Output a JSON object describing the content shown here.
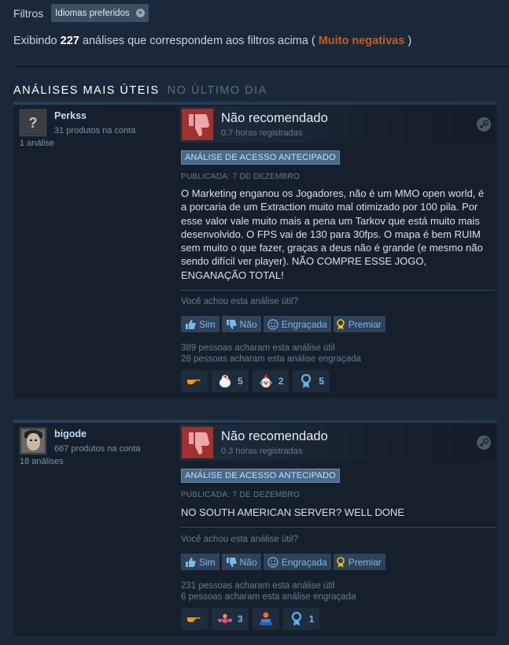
{
  "filters": {
    "label": "Filtros",
    "chip_label": "Idiomas preferidos",
    "chip_remove": "×"
  },
  "summary": {
    "prefix": "Exibindo",
    "count": "227",
    "middle": "análises que correspondem aos filtros acima (",
    "rating": "Muito negativas",
    "suffix": ")"
  },
  "section": {
    "title": "ANÁLISES MAIS ÚTEIS",
    "period": "NO ÚLTIMO DIA"
  },
  "colors": {
    "background": "#1b2838",
    "negative": "#c35c2c",
    "thumb_down": "#a13030",
    "link": "#7eb7e8"
  },
  "reviews": [
    {
      "author": "Perkss",
      "products_owned": "31 produtos na conta",
      "reviews_count": "1 análise",
      "avatar": "question-mark-avatar",
      "verdict": "Não recomendado",
      "hours": "0.7 horas registradas",
      "badge": "ANÁLISE DE ACESSO ANTECIPADO",
      "published": "PUBLICADA: 7 DE DEZEMBRO",
      "text": "O Marketing enganou os Jogadores, não é um MMO open world, é a porcaria de um Extraction muito mal otimizado por 100 pila. Por esse valor vale muito mais a pena um Tarkov que está muito mais desenvolvido. O FPS vai de 130 para 30fps. O mapa é bem RUIM sem muito o que fazer, graças a deus não é grande (e mesmo não sendo difícil ver player). NÃO COMPRE ESSE JOGO, ENGANAÇÃO TOTAL!",
      "helpful_question": "Você achou esta análise útil?",
      "buttons": {
        "yes": "Sim",
        "no": "Não",
        "funny": "Engraçada",
        "award": "Premiar"
      },
      "helpful_count": "389 pessoas acharam esta análise útil",
      "funny_count": "28 pessoas acharam esta análise engraçada",
      "awards": [
        {
          "icon": "hand-point-icon",
          "count": ""
        },
        {
          "icon": "chicken-icon",
          "count": "5"
        },
        {
          "icon": "clown-icon",
          "count": "2"
        },
        {
          "icon": "ribbon-medal-icon",
          "count": "5"
        }
      ]
    },
    {
      "author": "bigode",
      "products_owned": "667 produtos na conta",
      "reviews_count": "18 análises",
      "avatar": "face-avatar",
      "verdict": "Não recomendado",
      "hours": "0.3 horas registradas",
      "badge": "ANÁLISE DE ACESSO ANTECIPADO",
      "published": "PUBLICADA: 7 DE DEZEMBRO",
      "text": "NO SOUTH AMERICAN SERVER? WELL DONE",
      "helpful_question": "Você achou esta análise útil?",
      "buttons": {
        "yes": "Sim",
        "no": "Não",
        "funny": "Engraçada",
        "award": "Premiar"
      },
      "helpful_count": "231 pessoas acharam esta análise útil",
      "funny_count": "6 pessoas acharam esta análise engraçada",
      "awards": [
        {
          "icon": "hand-point-icon",
          "count": ""
        },
        {
          "icon": "hearts-icon",
          "count": "3"
        },
        {
          "icon": "pedestal-icon",
          "count": ""
        },
        {
          "icon": "ribbon-medal-icon",
          "count": "1"
        }
      ]
    }
  ]
}
